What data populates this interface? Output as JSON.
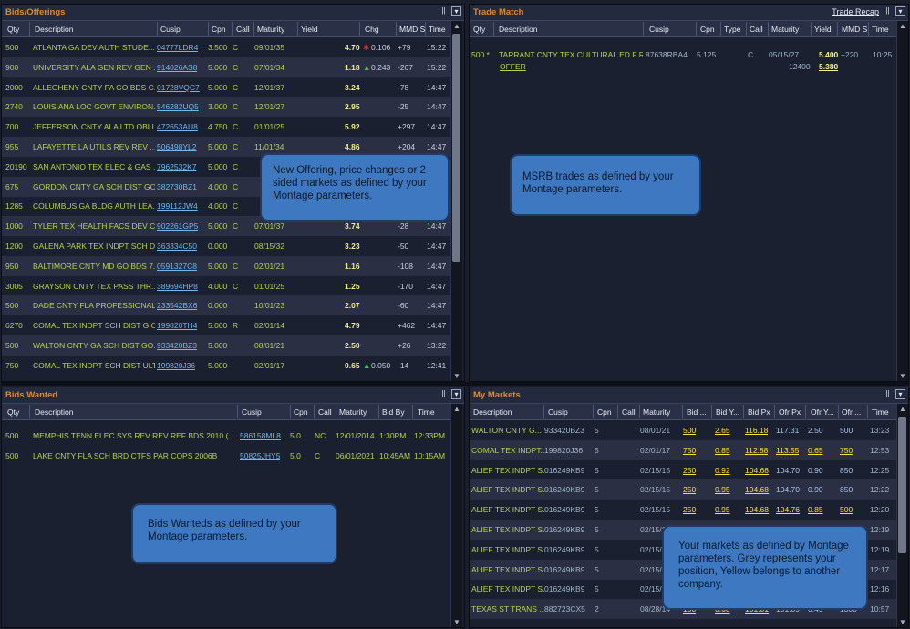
{
  "bids_offerings": {
    "title": "Bids/Offerings",
    "headers": [
      "Qty",
      "Description",
      "Cusip",
      "Cpn",
      "Call",
      "Maturity",
      "Yield",
      "Chg",
      "MMD S",
      "Time"
    ],
    "rows": [
      {
        "qty": "500",
        "desc": "ATLANTA GA DEV AUTH STUDE...",
        "cusip": "04777LDR4",
        "cpn": "3.500",
        "call": "C",
        "mat": "09/01/35",
        "yield": "4.70",
        "chg_dir": "down",
        "chg": "0.106",
        "mmd": "+79",
        "time": "15:22"
      },
      {
        "qty": "900",
        "desc": "UNIVERSITY ALA GEN REV GEN ...",
        "cusip": "914026AS8",
        "cpn": "5.000",
        "call": "C",
        "mat": "07/01/34",
        "yield": "1.18",
        "chg_dir": "up",
        "chg": "0.243",
        "mmd": "-267",
        "time": "15:22"
      },
      {
        "qty": "2000",
        "desc": "ALLEGHENY CNTY PA GO BDS C...",
        "cusip": "01728VQC7",
        "cpn": "5.000",
        "call": "C",
        "mat": "12/01/37",
        "yield": "3.24",
        "chg_dir": "",
        "chg": "",
        "mmd": "-78",
        "time": "14:47"
      },
      {
        "qty": "2740",
        "desc": "LOUISIANA LOC GOVT ENVIRON...",
        "cusip": "546282UQ5",
        "cpn": "3.000",
        "call": "C",
        "mat": "12/01/27",
        "yield": "2.95",
        "chg_dir": "",
        "chg": "",
        "mmd": "-25",
        "time": "14:47"
      },
      {
        "qty": "700",
        "desc": "JEFFERSON CNTY ALA LTD OBLI...",
        "cusip": "472653AU8",
        "cpn": "4.750",
        "call": "C",
        "mat": "01/01/25",
        "yield": "5.92",
        "chg_dir": "",
        "chg": "",
        "mmd": "+297",
        "time": "14:47"
      },
      {
        "qty": "955",
        "desc": "LAFAYETTE LA UTILS REV REV ...",
        "cusip": "506498YL2",
        "cpn": "5.000",
        "call": "C",
        "mat": "11/01/34",
        "yield": "4.86",
        "chg_dir": "",
        "chg": "",
        "mmd": "+204",
        "time": "14:47"
      },
      {
        "qty": "20190",
        "desc": "SAN ANTONIO TEX ELEC & GAS ...",
        "cusip": "7962532K7",
        "cpn": "5.000",
        "call": "C",
        "mat": "",
        "yield": "",
        "chg_dir": "",
        "chg": "",
        "mmd": "",
        "time": "14:47"
      },
      {
        "qty": "675",
        "desc": "GORDON CNTY GA SCH DIST GO...",
        "cusip": "382730BZ1",
        "cpn": "4.000",
        "call": "C",
        "mat": "",
        "yield": "",
        "chg_dir": "",
        "chg": "",
        "mmd": "",
        "time": "14:47"
      },
      {
        "qty": "1285",
        "desc": "COLUMBUS GA BLDG AUTH LEA...",
        "cusip": "199112JW4",
        "cpn": "4.000",
        "call": "C",
        "mat": "",
        "yield": "",
        "chg_dir": "",
        "chg": "",
        "mmd": "",
        "time": "14:47"
      },
      {
        "qty": "1000",
        "desc": "TYLER TEX HEALTH FACS DEV C...",
        "cusip": "902261GP5",
        "cpn": "5.000",
        "call": "C",
        "mat": "07/01/37",
        "yield": "3.74",
        "chg_dir": "",
        "chg": "",
        "mmd": "-28",
        "time": "14:47"
      },
      {
        "qty": "1200",
        "desc": "GALENA PARK TEX INDPT SCH DI...",
        "cusip": "363334C50",
        "cpn": "0.000",
        "call": "",
        "mat": "08/15/32",
        "yield": "3.23",
        "chg_dir": "",
        "chg": "",
        "mmd": "-50",
        "time": "14:47"
      },
      {
        "qty": "950",
        "desc": "BALTIMORE CNTY MD GO BDS 7...",
        "cusip": "0591327C8",
        "cpn": "5.000",
        "call": "C",
        "mat": "02/01/21",
        "yield": "1.16",
        "chg_dir": "",
        "chg": "",
        "mmd": "-108",
        "time": "14:47"
      },
      {
        "qty": "3005",
        "desc": "GRAYSON CNTY TEX PASS THR...",
        "cusip": "389694HP8",
        "cpn": "4.000",
        "call": "C",
        "mat": "01/01/25",
        "yield": "1.25",
        "chg_dir": "",
        "chg": "",
        "mmd": "-170",
        "time": "14:47"
      },
      {
        "qty": "500",
        "desc": "DADE CNTY FLA PROFESSIONAL...",
        "cusip": "233542BX6",
        "cpn": "0.000",
        "call": "",
        "mat": "10/01/23",
        "yield": "2.07",
        "chg_dir": "",
        "chg": "",
        "mmd": "-60",
        "time": "14:47"
      },
      {
        "qty": "6270",
        "desc": "COMAL TEX INDPT SCH DIST G O...",
        "cusip": "199820TH4",
        "cpn": "5.000",
        "call": "R",
        "mat": "02/01/14",
        "yield": "4.79",
        "chg_dir": "",
        "chg": "",
        "mmd": "+462",
        "time": "14:47"
      },
      {
        "qty": "500",
        "desc": "WALTON CNTY GA SCH DIST GO...",
        "cusip": "933420BZ3",
        "cpn": "5.000",
        "call": "",
        "mat": "08/01/21",
        "yield": "2.50",
        "chg_dir": "",
        "chg": "",
        "mmd": "+26",
        "time": "13:22"
      },
      {
        "qty": "750",
        "desc": "COMAL TEX INDPT SCH DIST ULT...",
        "cusip": "199820J36",
        "cpn": "5.000",
        "call": "",
        "mat": "02/01/17",
        "yield": "0.65",
        "chg_dir": "up",
        "chg": "0.050",
        "mmd": "-14",
        "time": "12:41"
      }
    ],
    "callout": "New Offering, price changes or 2 sided markets as defined by your Montage  parameters."
  },
  "trade_match": {
    "title": "Trade Match",
    "recap_link": "Trade Recap",
    "headers": [
      "Qty",
      "Description",
      "Cusip",
      "Cpn",
      "Type",
      "Call",
      "Maturity",
      "Yield",
      "MMD S",
      "Time"
    ],
    "row": {
      "qty": "500 *",
      "desc": "TARRANT CNTY TEX CULTURAL ED F R...",
      "cusip": "87638RBA4",
      "cpn": "5.125",
      "call": "C",
      "mat": "05/15/27",
      "yield": "5.400",
      "mmd": "+220",
      "time": "10:25",
      "offer": "OFFER",
      "qty2": "12400",
      "yield2": "5.380"
    },
    "callout": "MSRB trades as defined by your Montage parameters."
  },
  "bids_wanted": {
    "title": "Bids Wanted",
    "headers": [
      "Qty",
      "Description",
      "Cusip",
      "Cpn",
      "Call",
      "Maturity",
      "Bid By",
      "Time"
    ],
    "rows": [
      {
        "qty": "500",
        "desc": "MEMPHIS TENN ELEC SYS REV REV REF BDS 2010 (",
        "cusip": "586158ML8",
        "cpn": "5.0",
        "call": "NC",
        "mat": "12/01/2014",
        "bidby": "1:30PM",
        "time": "12:33PM"
      },
      {
        "qty": "500",
        "desc": "LAKE CNTY FLA SCH BRD CTFS PAR COPS 2006B",
        "cusip": "50825JHY5",
        "cpn": "5.0",
        "call": "C",
        "mat": "06/01/2021",
        "bidby": "10:45AM",
        "time": "10:15AM"
      }
    ],
    "callout": "Bids Wanteds as defined by your Montage parameters."
  },
  "my_markets": {
    "title": "My Markets",
    "headers": [
      "Description",
      "Cusip",
      "Cpn",
      "Call",
      "Maturity",
      "Bid ...",
      "Bid Y...",
      "Bid Px",
      "Ofr Px",
      "Ofr Y...",
      "Ofr ...",
      "Time"
    ],
    "rows": [
      {
        "desc": "WALTON CNTY G...",
        "cusip": "933420BZ3",
        "cpn": "5",
        "mat": "08/01/21",
        "bq": "500",
        "by": "2.65",
        "bp": "116.18",
        "op": "117.31",
        "oy": "2.50",
        "oq": "500",
        "time": "13:23",
        "bid_own": "yellow",
        "ofr_own": "grey"
      },
      {
        "desc": "COMAL TEX INDPT...",
        "cusip": "199820J36",
        "cpn": "5",
        "mat": "02/01/17",
        "bq": "750",
        "by": "0.85",
        "bp": "112.88",
        "op": "113.55",
        "oy": "0.65",
        "oq": "750",
        "time": "12:53",
        "bid_own": "yellow",
        "ofr_own": "yellow"
      },
      {
        "desc": "ALIEF TEX INDPT S...",
        "cusip": "016249KB9",
        "cpn": "5",
        "mat": "02/15/15",
        "bq": "250",
        "by": "0.92",
        "bp": "104.68",
        "op": "104.70",
        "oy": "0.90",
        "oq": "850",
        "time": "12:25",
        "bid_own": "yellow",
        "ofr_own": "grey"
      },
      {
        "desc": "ALIEF TEX INDPT S...",
        "cusip": "016249KB9",
        "cpn": "5",
        "mat": "02/15/15",
        "bq": "250",
        "by": "0.95",
        "bp": "104.68",
        "op": "104.70",
        "oy": "0.90",
        "oq": "850",
        "time": "12:22",
        "bid_own": "yellow",
        "ofr_own": "grey"
      },
      {
        "desc": "ALIEF TEX INDPT S...",
        "cusip": "016249KB9",
        "cpn": "5",
        "mat": "02/15/15",
        "bq": "250",
        "by": "0.95",
        "bp": "104.68",
        "op": "104.76",
        "oy": "0.85",
        "oq": "500",
        "time": "12:20",
        "bid_own": "yellow",
        "ofr_own": "yellow"
      },
      {
        "desc": "ALIEF TEX INDPT S...",
        "cusip": "016249KB9",
        "cpn": "5",
        "mat": "02/15/15",
        "bq": "",
        "by": "",
        "bp": "",
        "op": "",
        "oy": "",
        "oq": "",
        "time": "12:19",
        "bid_own": "yellow",
        "ofr_own": "grey"
      },
      {
        "desc": "ALIEF TEX INDPT S...",
        "cusip": "016249KB9",
        "cpn": "5",
        "mat": "02/15/15",
        "bq": "",
        "by": "",
        "bp": "",
        "op": "",
        "oy": "",
        "oq": "",
        "time": "12:19",
        "bid_own": "yellow",
        "ofr_own": "grey"
      },
      {
        "desc": "ALIEF TEX INDPT S...",
        "cusip": "016249KB9",
        "cpn": "5",
        "mat": "02/15/",
        "bq": "",
        "by": "",
        "bp": "",
        "op": "",
        "oy": "",
        "oq": "",
        "time": "12:17",
        "bid_own": "yellow",
        "ofr_own": "grey"
      },
      {
        "desc": "ALIEF TEX INDPT S...",
        "cusip": "016249KB9",
        "cpn": "5",
        "mat": "02/15/",
        "bq": "",
        "by": "",
        "bp": "",
        "op": "",
        "oy": "",
        "oq": "",
        "time": "12:16",
        "bid_own": "yellow",
        "ofr_own": "grey"
      },
      {
        "desc": "TEXAS ST TRANS ...",
        "cusip": "882723CX5",
        "cpn": "2",
        "mat": "08/28/14",
        "bq": "100",
        "by": "0.60",
        "bp": "101.01",
        "op": "101.09",
        "oy": "0.49",
        "oq": "1300",
        "time": "10:57",
        "bid_own": "yellow",
        "ofr_own": "grey"
      }
    ],
    "callout": "Your markets as defined by Montage parameters. Grey represents your position, Yellow belongs to another company."
  },
  "colors": {
    "accent_title": "#e08a28",
    "bond_text": "#b6d24a",
    "link_blue": "#6fb7ee",
    "other_company_yellow": "#ffe02a",
    "own_position_grey": "#c8d0e0",
    "callout_bg": "#3d78c0"
  },
  "icons": {
    "pause": "pause-icon",
    "collapse": "chevron-down-double-icon"
  }
}
